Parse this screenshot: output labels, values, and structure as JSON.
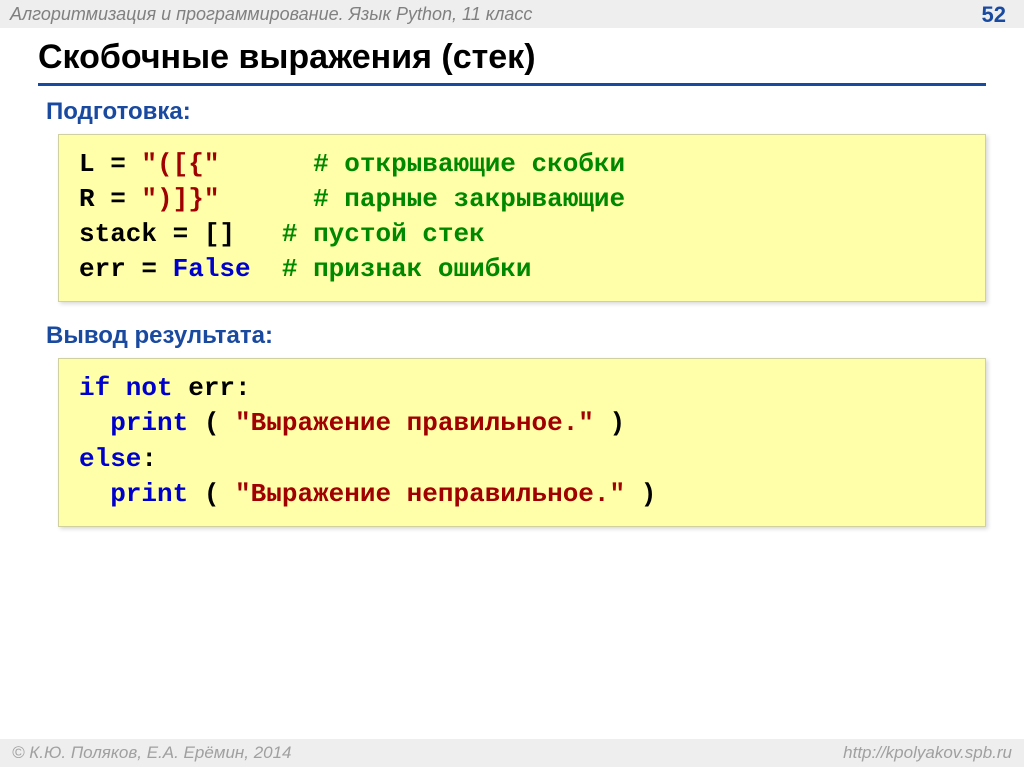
{
  "header": {
    "course": "Алгоритмизация и программирование. Язык Python, 11 класс",
    "page": "52"
  },
  "title": "Скобочные выражения (стек)",
  "sections": {
    "prep": "Подготовка:",
    "out": "Вывод результата:"
  },
  "code1": {
    "l_lhs": "L",
    "l_eq": " = ",
    "l_str": "\"([{\"",
    "l_cm": "# открывающие скобки",
    "r_lhs": "R",
    "r_eq": " = ",
    "r_str": "\")]}\"",
    "r_cm": "# парные закрывающие",
    "s_lhs": "stack",
    "s_eq": " = ",
    "s_val": "[]",
    "s_cm": "# пустой стек",
    "e_lhs": "err",
    "e_eq": " = ",
    "e_val": "False",
    "e_cm": "# признак ошибки",
    "gap1": "      ",
    "gap2": "      ",
    "gap3": "   ",
    "gap4": "  "
  },
  "code2": {
    "if_kw": "if not",
    "if_rest": " err:",
    "indent": "  ",
    "print": "print",
    "open": " ( ",
    "s1": "\"Выражение правильное.\"",
    "close": " )",
    "else_kw": "else",
    "colon": ":",
    "s2": "\"Выражение неправильное.\""
  },
  "footer": {
    "left": "© К.Ю. Поляков, Е.А. Ерёмин, 2014",
    "right": "http://kpolyakov.spb.ru"
  }
}
